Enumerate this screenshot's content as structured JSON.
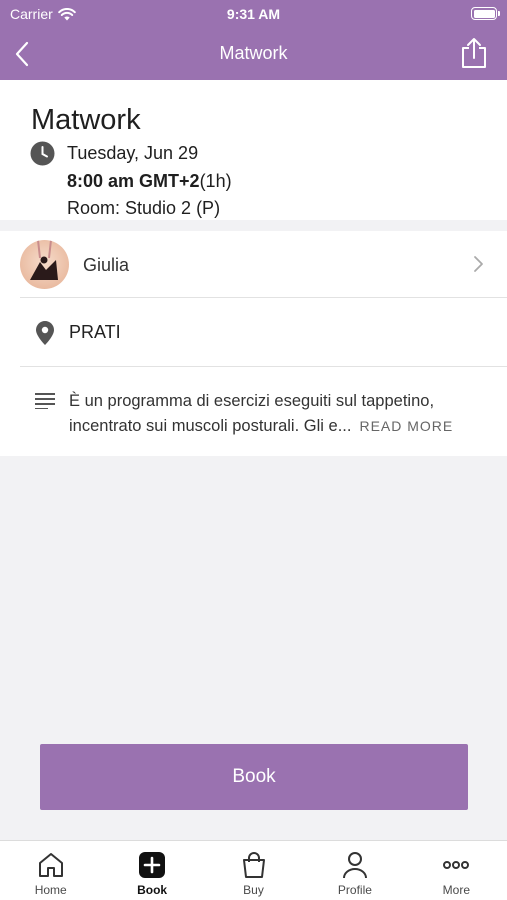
{
  "status_bar": {
    "carrier": "Carrier",
    "time": "9:31 AM"
  },
  "nav": {
    "title": "Matwork"
  },
  "class_info": {
    "title": "Matwork",
    "date": "Tuesday, Jun 29",
    "time": "8:00 am GMT+2",
    "duration": "(1h)",
    "room": "Room: Studio 2 (P)"
  },
  "instructor": {
    "name": "Giulia"
  },
  "location": {
    "name": "PRATI"
  },
  "description": {
    "text": "È un programma di esercizi eseguiti sul tappetino, incentrato sui muscoli posturali. Gli e...",
    "read_more": "READ MORE"
  },
  "book_button": {
    "label": "Book"
  },
  "tabs": [
    {
      "label": "Home",
      "icon": "home-icon"
    },
    {
      "label": "Book",
      "icon": "plus-square-icon",
      "active": true
    },
    {
      "label": "Buy",
      "icon": "shopping-bag-icon"
    },
    {
      "label": "Profile",
      "icon": "person-icon"
    },
    {
      "label": "More",
      "icon": "more-dots-icon"
    }
  ],
  "colors": {
    "accent": "#9a72b0",
    "background": "#f2f2f4"
  }
}
